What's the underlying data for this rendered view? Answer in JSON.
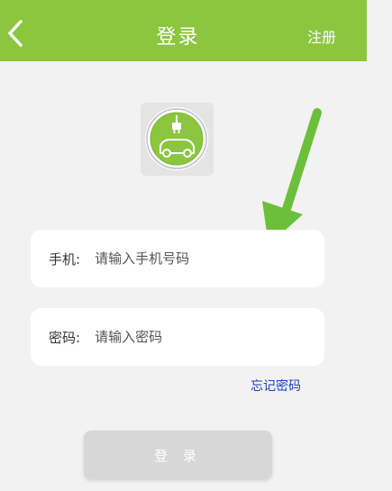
{
  "header": {
    "title": "登录",
    "register_label": "注册",
    "back_icon": "chevron-left-icon"
  },
  "logo": {
    "icon": "ev-charging-car-logo",
    "accent": "#8cc63f"
  },
  "annotation": {
    "icon": "green-arrow-pointer",
    "color": "#6cbf3a"
  },
  "form": {
    "phone": {
      "label": "手机:",
      "placeholder": "请输入手机号码",
      "value": ""
    },
    "password": {
      "label": "密码:",
      "placeholder": "请输入密码",
      "value": ""
    },
    "forgot_label": "忘记密码",
    "login_label": "登 录"
  },
  "colors": {
    "header_bg": "#8cc63f",
    "page_bg": "#f2f2f2",
    "link": "#1f3fb8",
    "button_disabled": "#d7d7d7"
  }
}
